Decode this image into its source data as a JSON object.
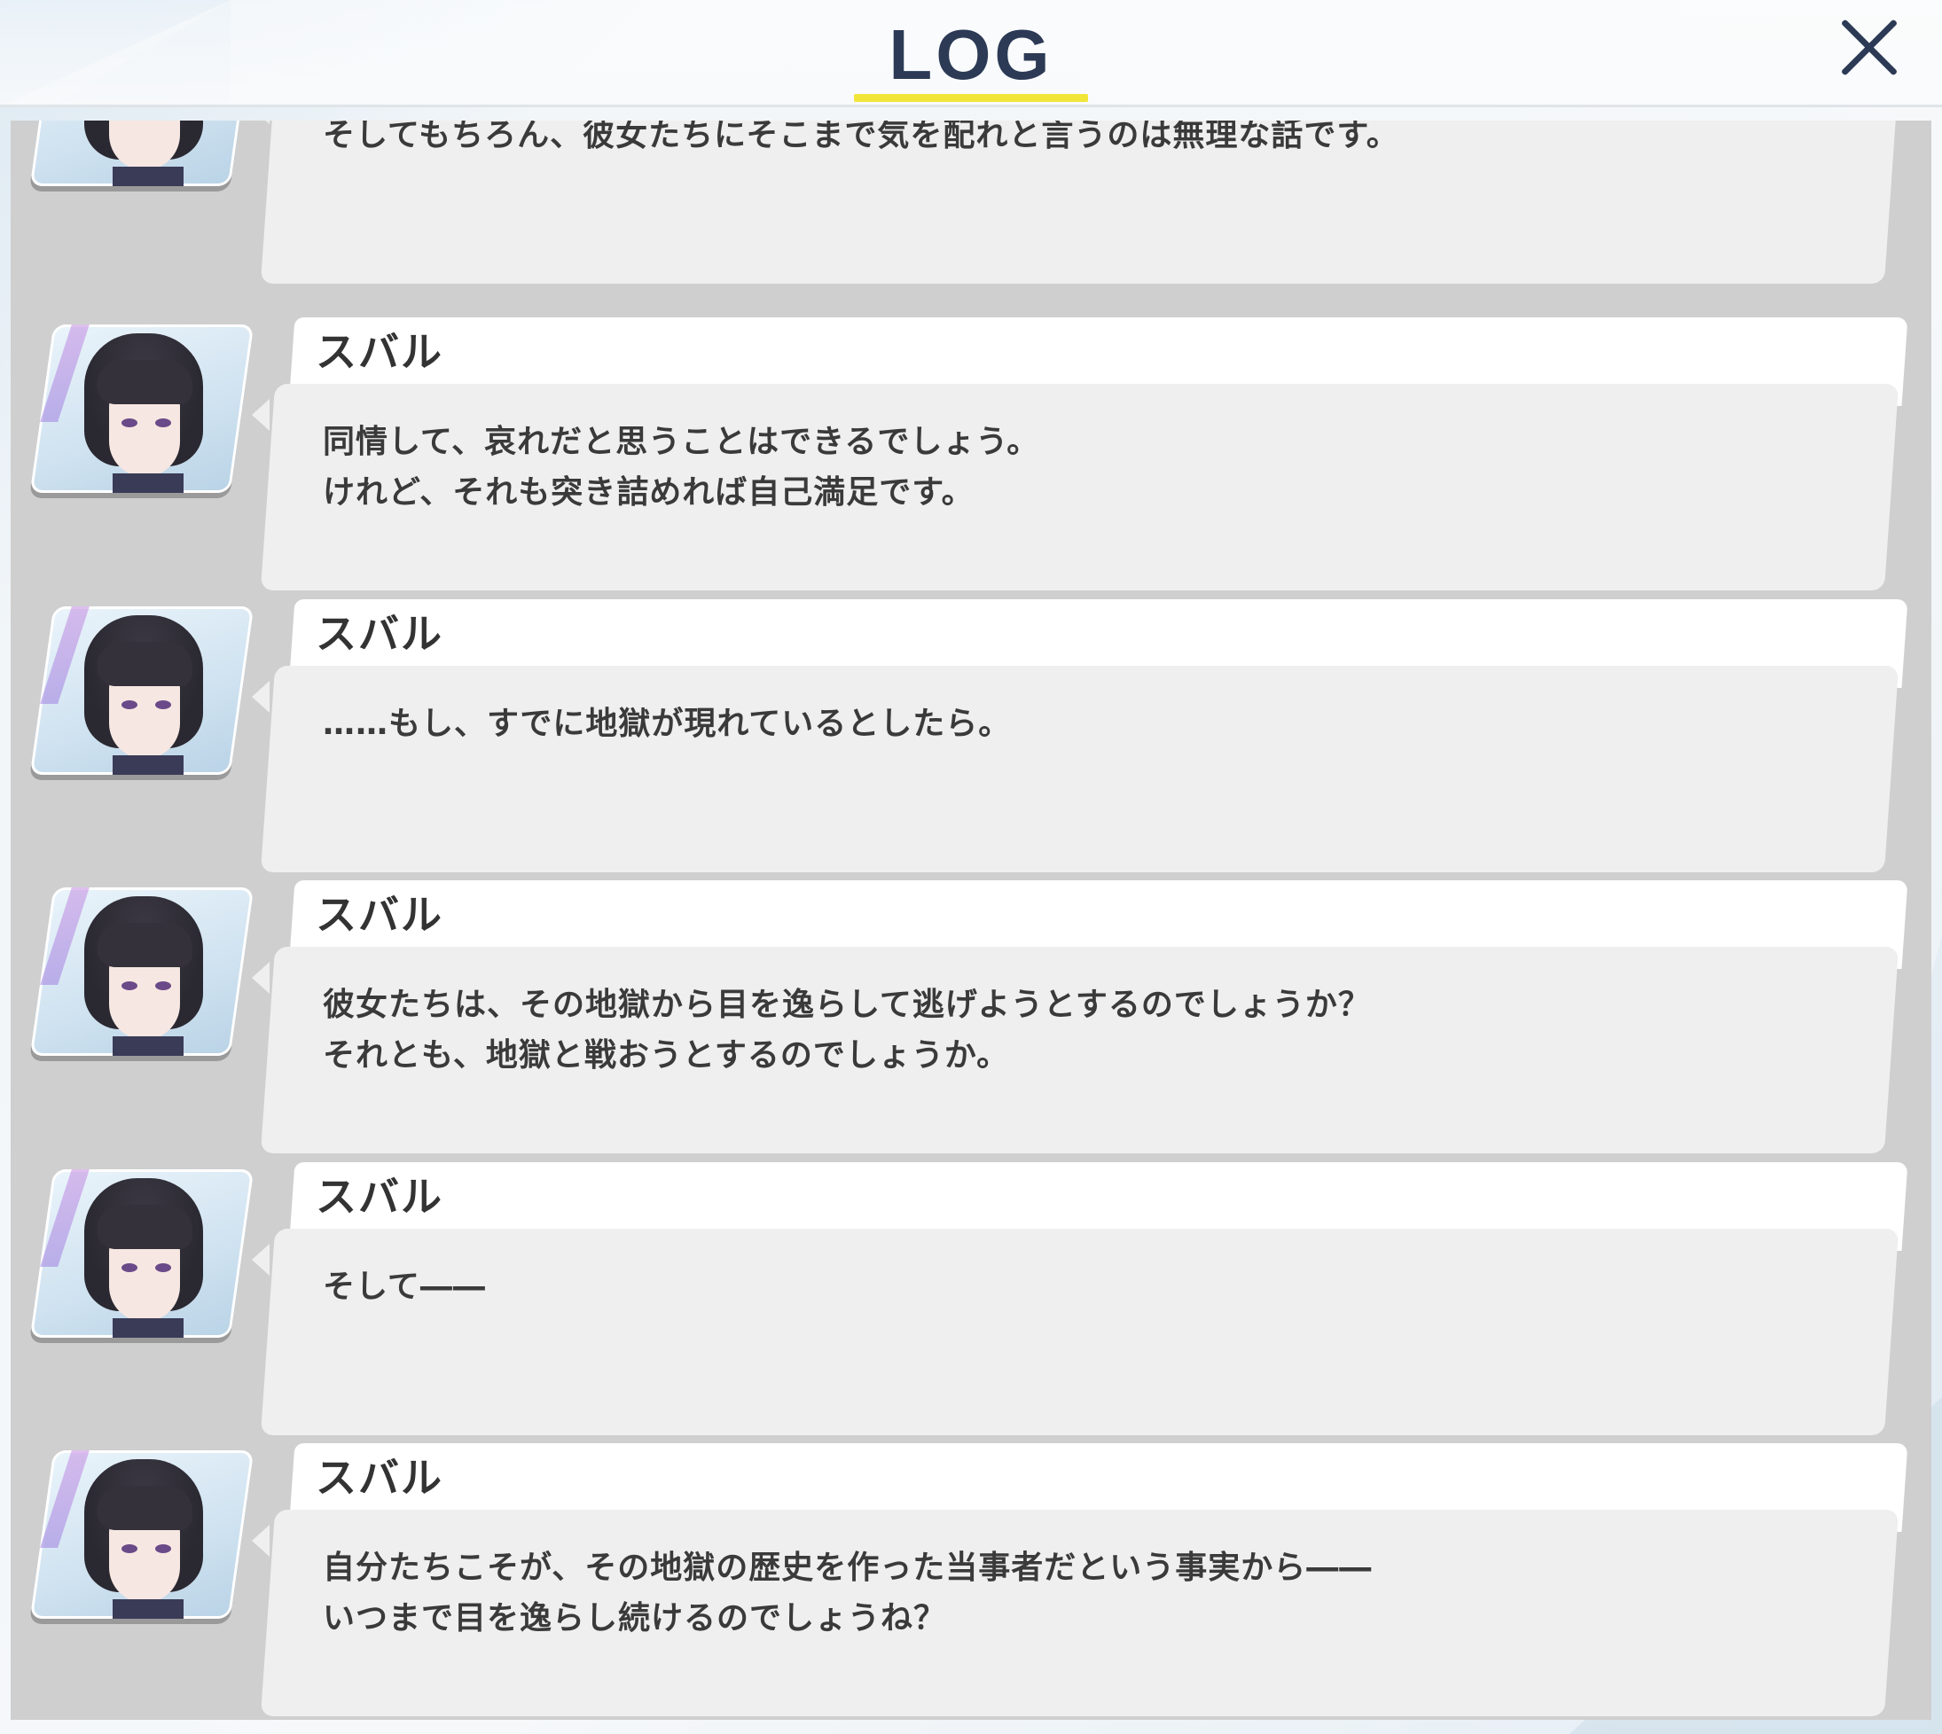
{
  "header": {
    "title": "LOG",
    "close_icon": "close-icon"
  },
  "entries": [
    {
      "name": "",
      "text": "そしてもちろん、彼女たちにそこまで気を配れと言うのは無理な話です。"
    },
    {
      "name": "スバル",
      "text": "同情して、哀れだと思うことはできるでしょう。\nけれど、それも突き詰めれば自己満足です。"
    },
    {
      "name": "スバル",
      "text": "……もし、すでに地獄が現れているとしたら。"
    },
    {
      "name": "スバル",
      "text": "彼女たちは、その地獄から目を逸らして逃げようとするのでしょうか？\nそれとも、地獄と戦おうとするのでしょうか。"
    },
    {
      "name": "スバル",
      "text": "そして――"
    },
    {
      "name": "スバル",
      "text": "自分たちこそが、その地獄の歴史を作った当事者だという事実から――\nいつまで目を逸らし続けるのでしょうね？"
    }
  ],
  "colors": {
    "title": "#2c3a55",
    "title_underline": "#f2e53a",
    "panel": "#cfcfcf",
    "bubble": "#efefef",
    "name_plate": "#ffffff"
  }
}
